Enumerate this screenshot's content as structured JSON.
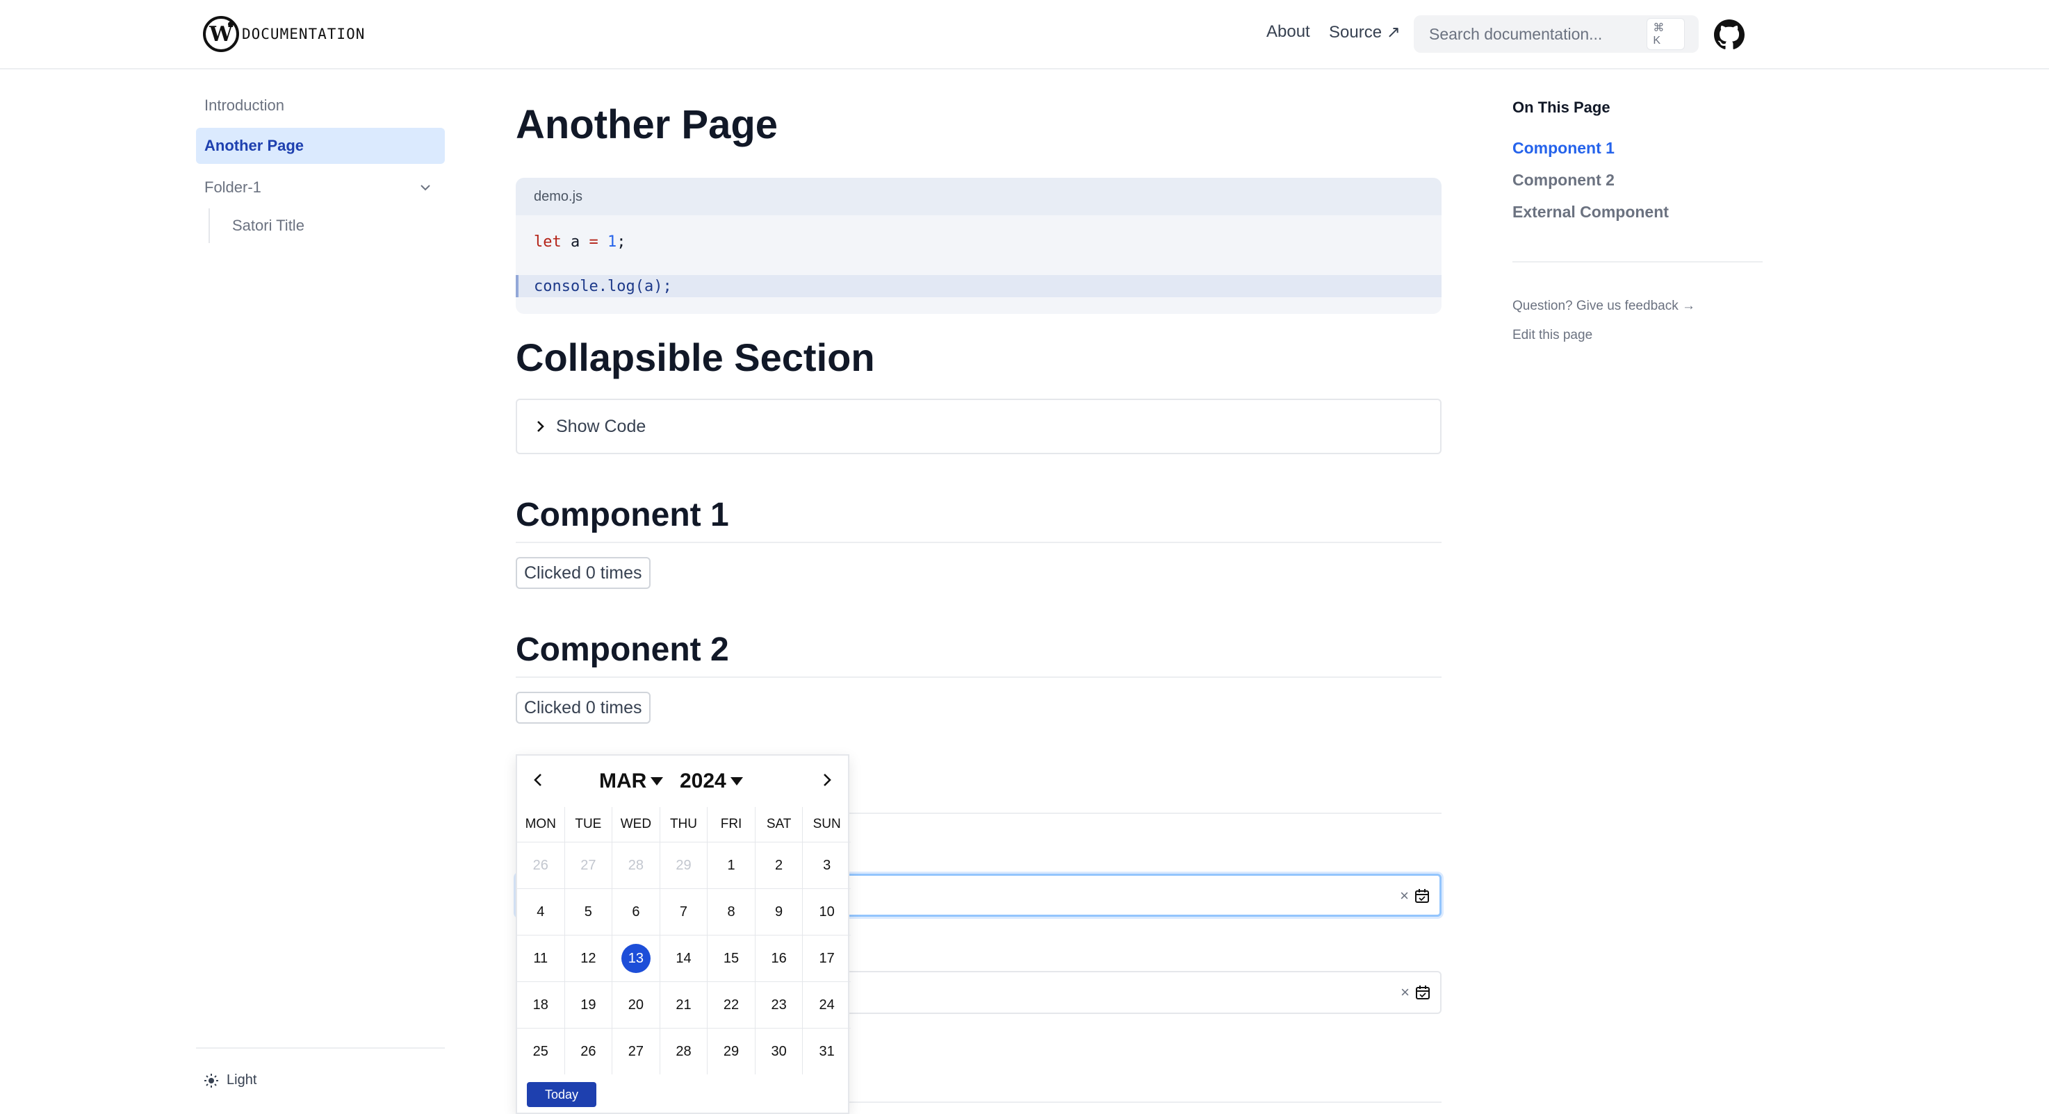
{
  "header": {
    "logo_text": "DOCUMENTATION",
    "nav": {
      "about": "About",
      "source": "Source ↗"
    },
    "search": {
      "placeholder": "Search documentation...",
      "shortcut": "⌘ K"
    }
  },
  "sidebar": {
    "items": [
      {
        "label": "Introduction"
      },
      {
        "label": "Another Page",
        "active": true
      },
      {
        "label": "Folder-1",
        "expanded": true
      },
      {
        "label": "Satori Title"
      }
    ],
    "theme_label": "Light"
  },
  "main": {
    "title": "Another Page",
    "code": {
      "filename": "demo.js",
      "line1": {
        "kw": "let",
        "rest1": " a ",
        "op": "=",
        "space": " ",
        "num": "1",
        "end": ";"
      },
      "line2": {
        "fn": "console",
        "dot": ".",
        "fn2": "log",
        "rest": "(a);"
      }
    },
    "collapsible": {
      "heading": "Collapsible Section",
      "summary": "Show Code"
    },
    "component1": {
      "heading": "Component 1",
      "button": "Clicked 0 times"
    },
    "component2": {
      "heading": "Component 2",
      "button": "Clicked 0 times"
    },
    "date_inputs": {
      "clear": "×"
    }
  },
  "calendar": {
    "month": "MAR",
    "year": "2024",
    "weekdays": [
      "MON",
      "TUE",
      "WED",
      "THU",
      "FRI",
      "SAT",
      "SUN"
    ],
    "weeks": [
      [
        "26",
        "27",
        "28",
        "29",
        "1",
        "2",
        "3"
      ],
      [
        "4",
        "5",
        "6",
        "7",
        "8",
        "9",
        "10"
      ],
      [
        "11",
        "12",
        "13",
        "14",
        "15",
        "16",
        "17"
      ],
      [
        "18",
        "19",
        "20",
        "21",
        "22",
        "23",
        "24"
      ],
      [
        "25",
        "26",
        "27",
        "28",
        "29",
        "30",
        "31"
      ]
    ],
    "selected": "13",
    "today_label": "Today"
  },
  "toc": {
    "title": "On This Page",
    "links": [
      {
        "label": "Component 1",
        "active": true
      },
      {
        "label": "Component 2"
      },
      {
        "label": "External Component"
      }
    ],
    "feedback": "Question? Give us feedback →",
    "edit": "Edit this page"
  },
  "colors": {
    "accent": "#2563eb",
    "active_bg": "#dbeafe",
    "today_button": "#1e40af"
  }
}
